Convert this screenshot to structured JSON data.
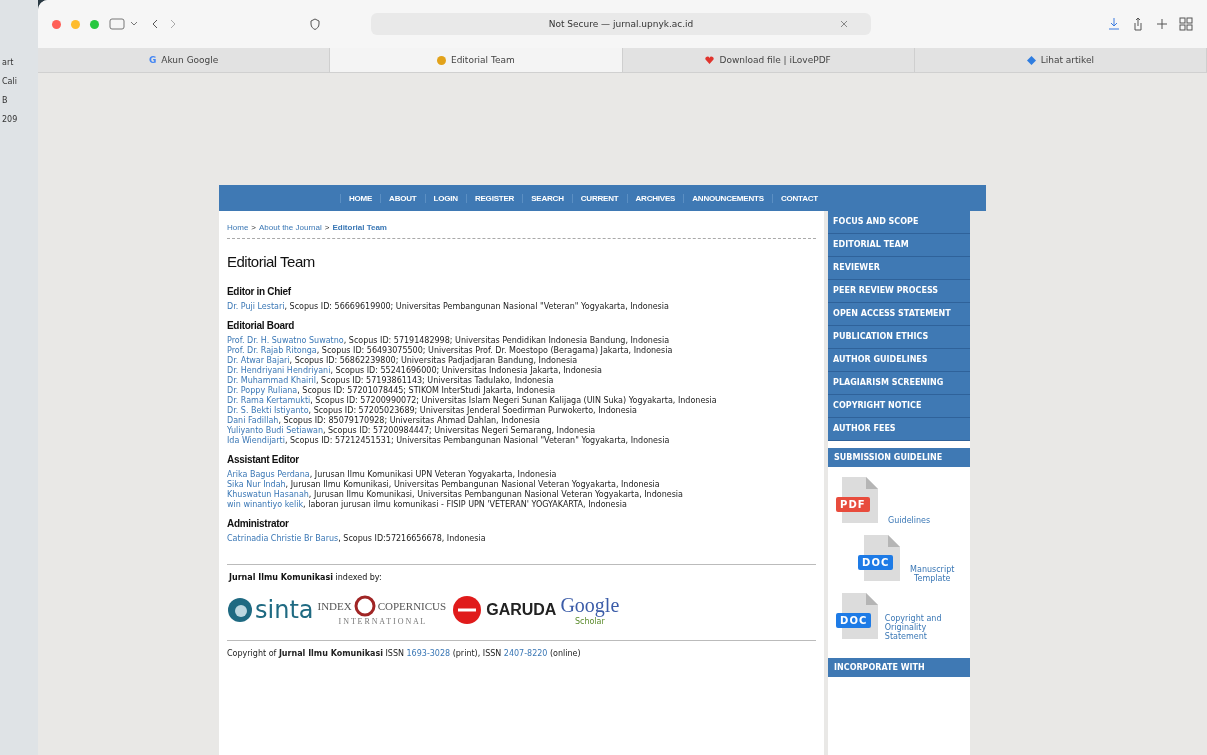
{
  "background_window": {
    "texts": [
      "art",
      "Cali",
      "B",
      "209"
    ]
  },
  "browser": {
    "address": "Not Secure — jurnal.upnyk.ac.id",
    "tabs": [
      {
        "label": "Akun Google",
        "icon_text": "G",
        "selected": false
      },
      {
        "label": "Editorial Team",
        "selected": true
      },
      {
        "label": "Download file | iLovePDF",
        "selected": false
      },
      {
        "label": "Lihat artikel",
        "selected": false
      }
    ]
  },
  "nav": [
    "HOME",
    "ABOUT",
    "LOGIN",
    "REGISTER",
    "SEARCH",
    "CURRENT",
    "ARCHIVES",
    "ANNOUNCEMENTS",
    "CONTACT"
  ],
  "breadcrumb": [
    {
      "label": "Home",
      "current": false
    },
    {
      "label": "About the Journal",
      "current": false
    },
    {
      "label": "Editorial Team",
      "current": true
    }
  ],
  "breadcrumb_separator": ">",
  "title": "Editorial Team",
  "sections": [
    {
      "heading": "Editor in Chief",
      "members": [
        {
          "name": "Dr. Puji Lestari",
          "detail": ", Scopus ID: 56669619900; Universitas Pembangunan Nasional \"Veteran\" Yogyakarta, Indonesia"
        }
      ]
    },
    {
      "heading": "Editorial Board",
      "members": [
        {
          "name": "Prof. Dr. H. Suwatno Suwatno",
          "detail": ", Scopus ID: 57191482998; Universitas Pendidikan Indonesia Bandung, Indonesia"
        },
        {
          "name": "Prof. Dr. Rajab Ritonga",
          "detail": ", Scopus ID: 56493075500; Universitas Prof. Dr. Moestopo (Beragama) Jakarta, Indonesia"
        },
        {
          "name": "Dr. Atwar Bajari",
          "detail": ", Scopus ID: 56862239800; Universitas Padjadjaran Bandung, Indonesia"
        },
        {
          "name": "Dr. Hendriyani Hendriyani",
          "detail": ", Scopus ID: 55241696000; Universitas Indonesia Jakarta, Indonesia"
        },
        {
          "name": "Dr. Muhammad Khairil",
          "detail": ", Scopus ID: 57193861143; Universitas Tadulako, Indonesia"
        },
        {
          "name": "Dr. Poppy Ruliana",
          "detail": ", Scopus ID: 57201078445; STIKOM InterStudi Jakarta, Indonesia"
        },
        {
          "name": "Dr. Rama Kertamukti",
          "detail": ", Scopus ID: 57200990072; Universitas Islam Negeri Sunan Kalijaga (UIN Suka) Yogyakarta, Indonesia"
        },
        {
          "name": "Dr. S. Bekti Istiyanto",
          "detail": ", Scopus ID: 57205023689; Universitas Jenderal Soedirman Purwokerto, Indonesia"
        },
        {
          "name": "Dani Fadillah",
          "detail": ", Scopus ID: 85079170928; Universitas Ahmad Dahlan, Indonesia"
        },
        {
          "name": "Yuliyanto Budi Setiawan",
          "detail": ", Scopus ID: 57200984447; Universitas Negeri Semarang, Indonesia"
        },
        {
          "name": "Ida Wiendijarti",
          "detail": ", Scopus ID: 57212451531; Universitas Pembangunan Nasional \"Veteran\" Yogyakarta, Indonesia"
        }
      ]
    },
    {
      "heading": "Assistant Editor",
      "members": [
        {
          "name": "Arika Bagus Perdana",
          "detail": ", Jurusan Ilmu Komunikasi UPN Veteran Yogyakarta, Indonesia"
        },
        {
          "name": "Sika Nur Indah",
          "detail": ", Jurusan Ilmu Komunikasi, Universitas Pembangunan Nasional Veteran Yogyakarta, Indonesia"
        },
        {
          "name": "Khuswatun Hasanah",
          "detail": ", Jurusan Ilmu Komunikasi, Universitas Pembangunan Nasional Veteran Yogyakarta, Indonesia"
        },
        {
          "name": "win winantiyo kelik",
          "detail": ", laboran jurusan ilmu komunikasi - FISIP UPN 'VETERAN' YOGYAKARTA, Indonesia"
        }
      ]
    },
    {
      "heading": "Administrator",
      "members": [
        {
          "name": "Catrinadia Christie Br Barus",
          "detail": ", Scopus ID:57216656678, Indonesia"
        }
      ]
    }
  ],
  "indexed_by": "**Jurnal Ilmu Komunikasi** indexed by:",
  "indexers": [
    {
      "kind": "sinta",
      "words": [
        "sinta"
      ]
    },
    {
      "kind": "copernicus",
      "words": [
        "INDEX",
        "COPERNICUS",
        "I N T E R N A T I O N A L"
      ]
    },
    {
      "kind": "garuda",
      "words": [
        "GARUDA"
      ]
    },
    {
      "kind": "scholar",
      "words": [
        "Google",
        "Scholar"
      ]
    }
  ],
  "copyright": {
    "prefix": "Copyright of **Jurnal Ilmu Komunikasi** ISSN ",
    "print_issn": "1693-3028",
    "middle": " (print), ISSN ",
    "online_issn": "2407-8220",
    "suffix": " (online)"
  },
  "sidebar": {
    "menu": [
      "FOCUS AND SCOPE",
      "EDITORIAL TEAM",
      "REVIEWER",
      "PEER REVIEW PROCESS",
      "OPEN ACCESS STATEMENT",
      "PUBLICATION ETHICS",
      "AUTHOR GUIDELINES",
      "PLAGIARISM SCREENING",
      "COPYRIGHT NOTICE",
      "AUTHOR FEES"
    ],
    "submission_heading": "SUBMISSION GUIDELINE",
    "files": [
      {
        "kind": "pdf",
        "badge": "PDF",
        "labels": [
          "Guidelines"
        ]
      },
      {
        "kind": "doc",
        "badge": "DOC",
        "labels": [
          "Manuscript",
          "Template"
        ]
      },
      {
        "kind": "doc",
        "badge": "DOC",
        "labels": [
          "Copyright and Originality Statement"
        ]
      }
    ],
    "bottom_heading": "INCORPORATE WITH"
  }
}
